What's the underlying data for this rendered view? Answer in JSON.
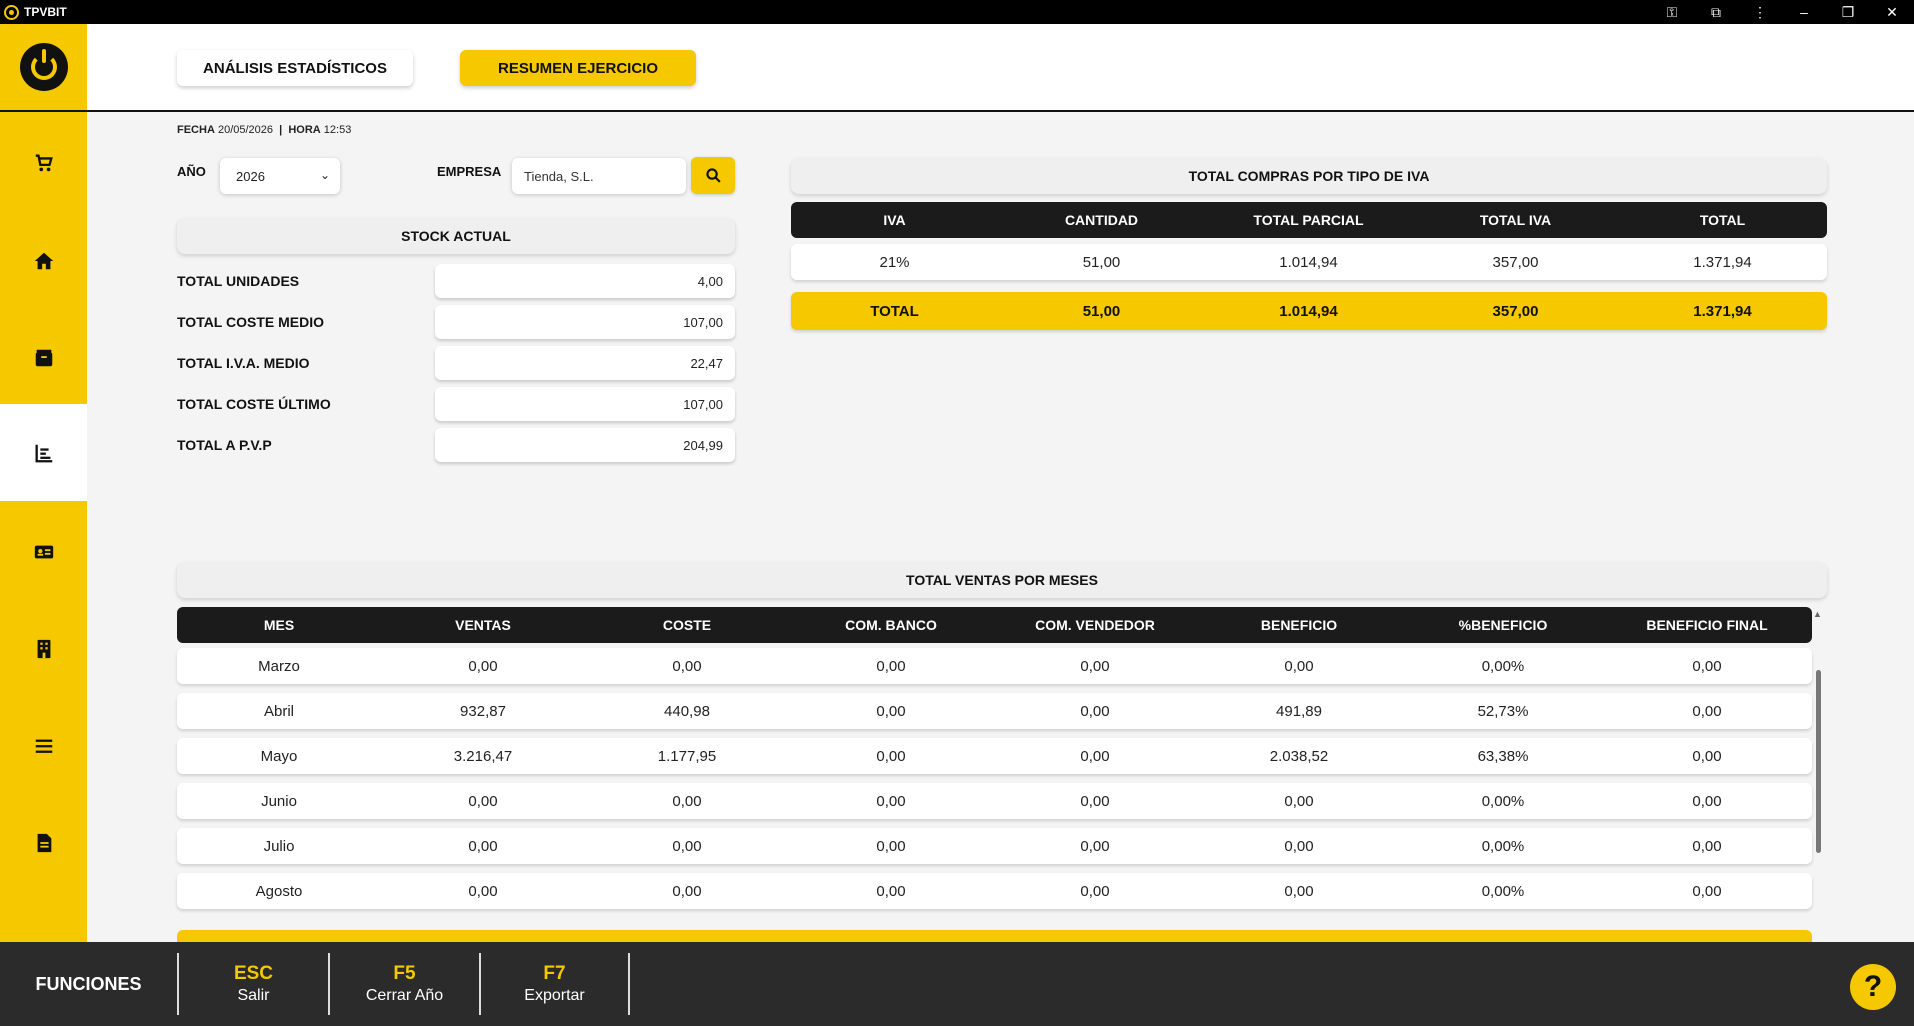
{
  "window": {
    "title": "TPVBIT",
    "controls": [
      "key-icon",
      "extension-icon",
      "more-icon",
      "minimize",
      "restore",
      "close"
    ]
  },
  "colors": {
    "accent": "#f5c800",
    "dark": "#1b1b1b",
    "bar": "#2b2b2b"
  },
  "sidebar": {
    "items": [
      {
        "icon": "cart-icon"
      },
      {
        "icon": "home-icon"
      },
      {
        "icon": "box-icon"
      },
      {
        "icon": "chart-icon",
        "active": true
      },
      {
        "icon": "id-card-icon"
      },
      {
        "icon": "building-icon"
      },
      {
        "icon": "menu-icon"
      },
      {
        "icon": "document-icon"
      }
    ]
  },
  "tabs": {
    "analisis": "ANÁLISIS ESTADÍSTICOS",
    "resumen": "RESUMEN EJERCICIO"
  },
  "dateline": {
    "fecha_label": "FECHA",
    "fecha": "20/05/2026",
    "sep": "|",
    "hora_label": "HORA",
    "hora": "12:53"
  },
  "filters": {
    "anio_label": "AÑO",
    "anio_value": "2026",
    "empresa_label": "EMPRESA",
    "empresa_value": "Tienda, S.L."
  },
  "stock": {
    "title": "STOCK ACTUAL",
    "rows": [
      {
        "label": "TOTAL UNIDADES",
        "value": "4,00"
      },
      {
        "label": "TOTAL COSTE MEDIO",
        "value": "107,00"
      },
      {
        "label": "TOTAL I.V.A. MEDIO",
        "value": "22,47"
      },
      {
        "label": "TOTAL COSTE ÚLTIMO",
        "value": "107,00"
      },
      {
        "label": "TOTAL A P.V.P",
        "value": "204,99"
      }
    ]
  },
  "compras": {
    "title": "TOTAL COMPRAS POR TIPO DE IVA",
    "headers": [
      "IVA",
      "CANTIDAD",
      "TOTAL PARCIAL",
      "TOTAL IVA",
      "TOTAL"
    ],
    "rows": [
      [
        "21%",
        "51,00",
        "1.014,94",
        "357,00",
        "1.371,94"
      ]
    ],
    "total": [
      "TOTAL",
      "51,00",
      "1.014,94",
      "357,00",
      "1.371,94"
    ]
  },
  "ventas": {
    "title": "TOTAL VENTAS POR MESES",
    "headers": [
      "MES",
      "VENTAS",
      "COSTE",
      "COM. BANCO",
      "COM. VENDEDOR",
      "BENEFICIO",
      "%BENEFICIO",
      "BENEFICIO FINAL"
    ],
    "rows": [
      [
        "Marzo",
        "0,00",
        "0,00",
        "0,00",
        "0,00",
        "0,00",
        "0,00%",
        "0,00"
      ],
      [
        "Abril",
        "932,87",
        "440,98",
        "0,00",
        "0,00",
        "491,89",
        "52,73%",
        "0,00"
      ],
      [
        "Mayo",
        "3.216,47",
        "1.177,95",
        "0,00",
        "0,00",
        "2.038,52",
        "63,38%",
        "0,00"
      ],
      [
        "Junio",
        "0,00",
        "0,00",
        "0,00",
        "0,00",
        "0,00",
        "0,00%",
        "0,00"
      ],
      [
        "Julio",
        "0,00",
        "0,00",
        "0,00",
        "0,00",
        "0,00",
        "0,00%",
        "0,00"
      ],
      [
        "Agosto",
        "0,00",
        "0,00",
        "0,00",
        "0,00",
        "0,00",
        "0,00%",
        "0,00"
      ]
    ]
  },
  "bottom": {
    "funciones": "FUNCIONES",
    "keys": [
      {
        "key": "ESC",
        "label": "Salir"
      },
      {
        "key": "F5",
        "label": "Cerrar Año"
      },
      {
        "key": "F7",
        "label": "Exportar"
      }
    ],
    "help": "?"
  }
}
